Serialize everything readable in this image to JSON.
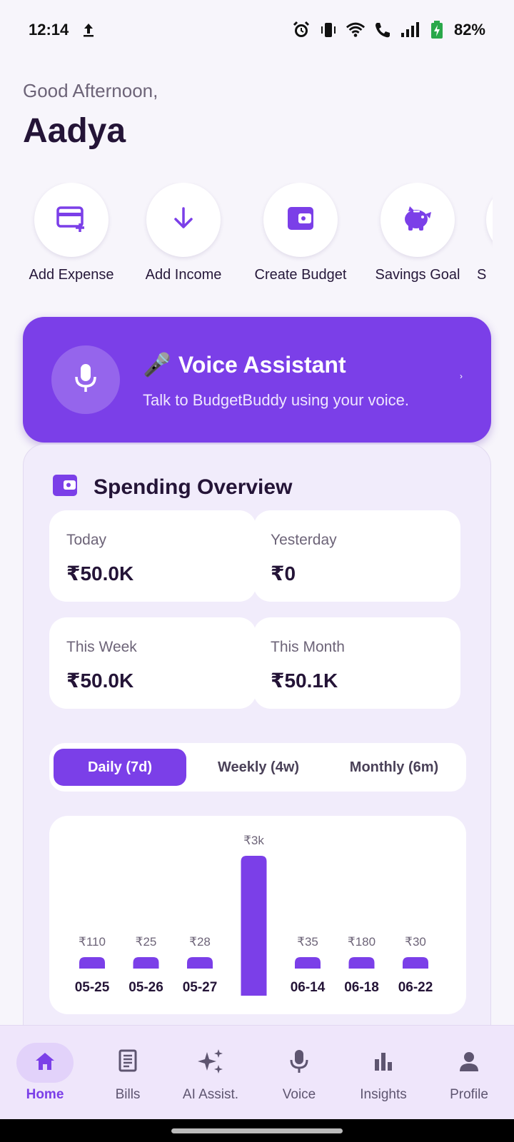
{
  "status_bar": {
    "time": "12:14",
    "battery": "82%",
    "icons": [
      "upload-icon",
      "alarm-icon",
      "vibrate-icon",
      "wifi-icon",
      "call-icon",
      "signal-icon",
      "battery-icon"
    ]
  },
  "greeting": "Good Afternoon,",
  "username": "Aadya",
  "quick_actions": [
    {
      "label": "Add Expense",
      "icon": "card-add-icon"
    },
    {
      "label": "Add Income",
      "icon": "arrow-down-icon"
    },
    {
      "label": "Create Budget",
      "icon": "wallet-icon"
    },
    {
      "label": "Savings Goal",
      "icon": "piggy-bank-icon"
    },
    {
      "label": "S",
      "icon": "more-icon"
    }
  ],
  "voice_card": {
    "emoji": "🎤",
    "title": "Voice Assistant",
    "subtitle": "Talk to BudgetBuddy using your voice.",
    "arrow": "›"
  },
  "overview": {
    "title": "Spending Overview",
    "stats": [
      {
        "label": "Today",
        "value": "₹50.0K"
      },
      {
        "label": "Yesterday",
        "value": "₹0"
      },
      {
        "label": "This Week",
        "value": "₹50.0K"
      },
      {
        "label": "This Month",
        "value": "₹50.1K"
      }
    ],
    "tabs": [
      {
        "label": "Daily (7d)",
        "active": true
      },
      {
        "label": "Weekly (4w)",
        "active": false
      },
      {
        "label": "Monthly (6m)",
        "active": false
      }
    ]
  },
  "chart_data": {
    "type": "bar",
    "categories": [
      "05-25",
      "05-26",
      "05-27",
      "",
      "06-14",
      "06-18",
      "06-22"
    ],
    "values": [
      110,
      25,
      28,
      3000,
      35,
      180,
      30
    ],
    "data_labels": [
      "₹110",
      "₹25",
      "₹28",
      "₹3k",
      "₹35",
      "₹180",
      "₹30"
    ],
    "bar_color": "#7b3fe8",
    "grid": false
  },
  "bottom_nav": [
    {
      "label": "Home",
      "icon": "home-icon",
      "active": true
    },
    {
      "label": "Bills",
      "icon": "bills-icon",
      "active": false
    },
    {
      "label": "AI Assist.",
      "icon": "sparkles-icon",
      "active": false
    },
    {
      "label": "Voice",
      "icon": "mic-icon",
      "active": false
    },
    {
      "label": "Insights",
      "icon": "bar-chart-icon",
      "active": false
    },
    {
      "label": "Profile",
      "icon": "person-icon",
      "active": false
    }
  ],
  "colors": {
    "accent": "#7b3fe8",
    "text": "#241437",
    "muted": "#6d6478"
  }
}
